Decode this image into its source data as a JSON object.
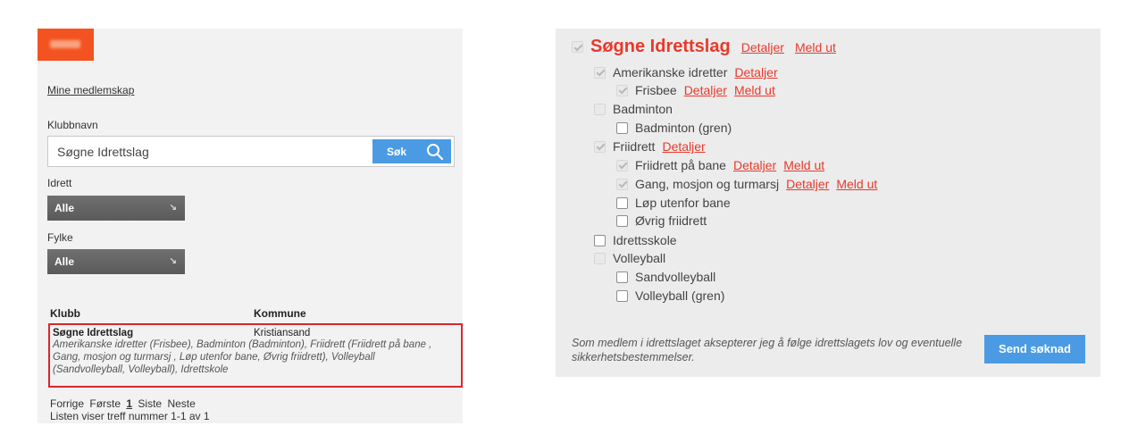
{
  "left": {
    "my_memberships_link": "Mine medlemskap",
    "club_name_label": "Klubbnavn",
    "club_name_value": "Søgne Idrettslag",
    "search_button": "Søk",
    "sport_label": "Idrett",
    "sport_value": "Alle",
    "county_label": "Fylke",
    "county_value": "Alle",
    "columns": {
      "club": "Klubb",
      "municipality": "Kommune"
    },
    "result": {
      "name": "Søgne Idrettslag",
      "municipality": "Kristiansand",
      "sports": "Amerikanske idretter (Frisbee), Badminton (Badminton), Friidrett (Friidrett på bane , Gang, mosjon og turmarsj , Løp utenfor bane, Øvrig friidrett), Volleyball (Sandvolleyball, Volleyball), Idrettskole"
    },
    "pager": {
      "prev": "Forrige",
      "first": "Første",
      "current": "1",
      "last": "Siste",
      "next": "Neste"
    },
    "count_text": "Listen viser treff nummer 1-1 av 1"
  },
  "right": {
    "root": {
      "name": "Søgne Idrettslag",
      "details": "Detaljer",
      "leave": "Meld ut"
    },
    "items": [
      {
        "name": "Amerikanske idretter",
        "details": "Detaljer"
      },
      {
        "name": "Frisbee",
        "details": "Detaljer",
        "leave": "Meld ut"
      },
      {
        "name": "Badminton"
      },
      {
        "name": "Badminton (gren)"
      },
      {
        "name": "Friidrett",
        "details": "Detaljer"
      },
      {
        "name": "Friidrett på bane",
        "details": "Detaljer",
        "leave": "Meld ut"
      },
      {
        "name": "Gang, mosjon og turmarsj",
        "details": "Detaljer",
        "leave": "Meld ut"
      },
      {
        "name": "Løp utenfor bane"
      },
      {
        "name": "Øvrig friidrett"
      },
      {
        "name": "Idrettsskole"
      },
      {
        "name": "Volleyball"
      },
      {
        "name": "Sandvolleyball"
      },
      {
        "name": "Volleyball (gren)"
      }
    ],
    "footnote": "Som medlem i idrettslaget aksepterer jeg å følge idrettslagets lov og eventuelle sikkerhetsbestemmelser.",
    "send_button": "Send søknad"
  },
  "colors": {
    "accent": "#e8392b",
    "button_blue": "#4a9be3",
    "logo_orange": "#f35320",
    "highlight_border": "#d9262f"
  },
  "icons": {
    "search": "magnifier-icon",
    "dropdown": "arrow-down-right-icon",
    "checkbox": "checkmark-icon"
  }
}
